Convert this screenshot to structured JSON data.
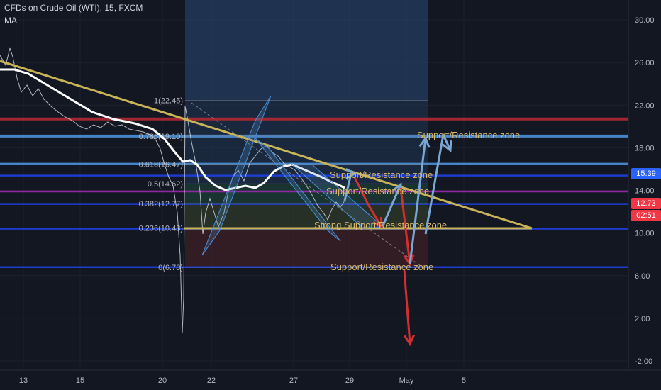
{
  "header": {
    "symbol_title": "CFDs on Crude Oil (WTI), 15, FXCM",
    "indicator": "MA"
  },
  "price_tags": [
    {
      "text": "15.39",
      "color": "#2962ff"
    },
    {
      "text": "12.73",
      "color": "#f23645"
    },
    {
      "text": "02:51",
      "color": "#f23645"
    }
  ],
  "chart_data": {
    "type": "line",
    "title": "CFDs on Crude Oil (WTI), 15, FXCM",
    "y_ticks": [
      "30.00",
      "26.00",
      "22.00",
      "18.00",
      "14.00",
      "10.00",
      "6.00",
      "2.00",
      "-2.00"
    ],
    "y_tick_values": [
      30,
      26,
      22,
      18,
      14,
      10,
      6,
      2,
      -2
    ],
    "ylim": [
      -2.5,
      31
    ],
    "x_ticks": [
      "13",
      "15",
      "20",
      "22",
      "27",
      "29",
      "May",
      "5"
    ],
    "fib_levels": [
      {
        "label": "1(22.45)",
        "value": 22.45
      },
      {
        "label": "0.786(19.10)",
        "value": 19.1
      },
      {
        "label": "0.618(16.47)",
        "value": 16.47
      },
      {
        "label": "0.5(14.62)",
        "value": 14.62
      },
      {
        "label": "0.382(12.77)",
        "value": 12.77
      },
      {
        "label": "0.236(10.48)",
        "value": 10.48
      },
      {
        "label": "0(6.78)",
        "value": 6.78
      }
    ],
    "horizontal_levels": [
      {
        "value": 20.7,
        "color": "#b22833"
      },
      {
        "value": 19.1,
        "color": "#4a90d9"
      },
      {
        "value": 16.5,
        "color": "#4a90d9"
      },
      {
        "value": 15.39,
        "color": "#1f3fe0"
      },
      {
        "value": 13.9,
        "color": "#9c27b0"
      },
      {
        "value": 12.73,
        "color": "#1f3fe0"
      },
      {
        "value": 10.4,
        "color": "#1f3fe0"
      },
      {
        "value": 6.8,
        "color": "#1f3fe0"
      }
    ],
    "annotations": [
      "Support/Resistance zone",
      "Support/Resistance zone",
      "Support/Resistance zone",
      "Strong Support/Resistance zone",
      "Support/Resistance zone"
    ],
    "colors": {
      "price": "#d1d4dc",
      "ma": "#ffffff",
      "trendline": "#c9b458",
      "bull_arrow": "#79a6d2",
      "bear_arrow": "#d32f2f"
    }
  }
}
